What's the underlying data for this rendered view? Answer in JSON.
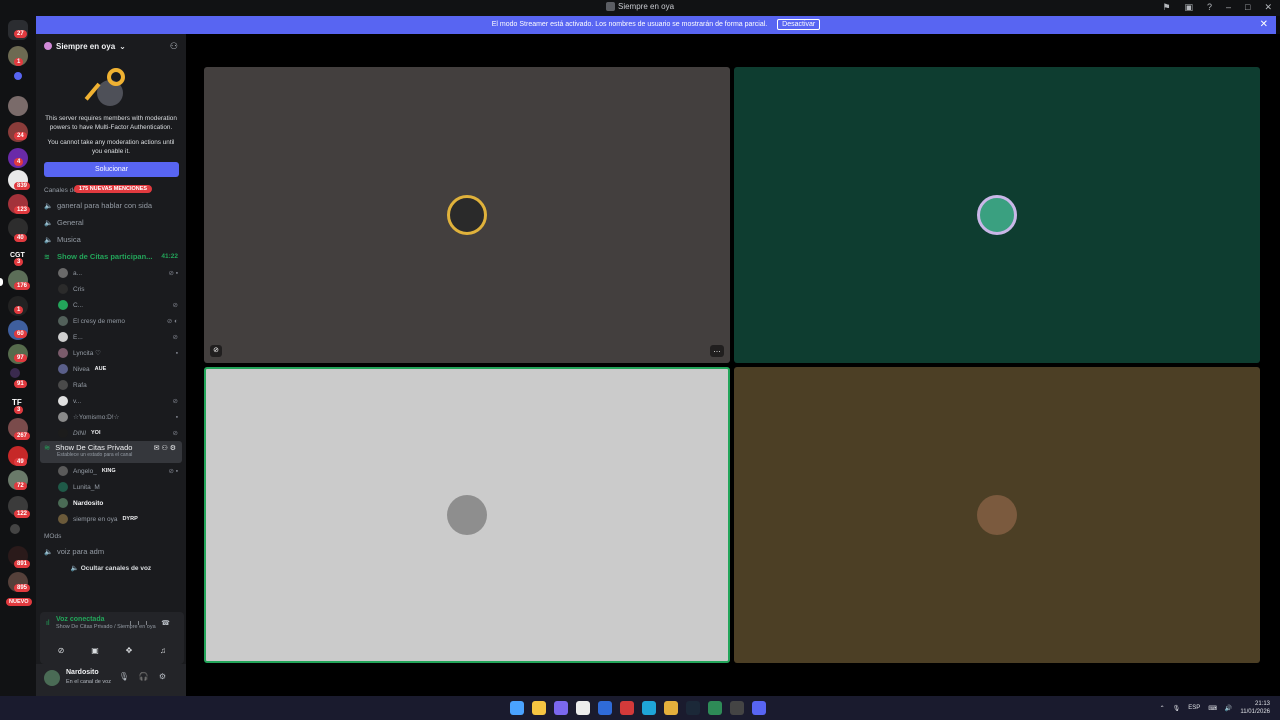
{
  "window": {
    "title": "Siempre en oya"
  },
  "banner": {
    "text": "El modo Streamer está activado. Los nombres de usuario se mostrarán de forma parcial.",
    "button": "Desactivar"
  },
  "rail_badges": [
    "27",
    "1",
    "24",
    "4",
    "839",
    "123",
    "40",
    "3",
    "176",
    "1",
    "60",
    "97",
    "91",
    "3",
    "267",
    "49",
    "72",
    "122",
    "891",
    "895"
  ],
  "rail_new": "NUEVO",
  "rail_text": {
    "cgt": "CGT",
    "tf": "TF"
  },
  "server": {
    "name": "Siempre en oya",
    "mfa_line1": "This server requires members with moderation powers to have Multi-Factor Authentication.",
    "mfa_line2": "You cannot take any moderation actions until you enable it.",
    "fix_button": "Solucionar"
  },
  "category": {
    "name": "Canales de",
    "mentions": "175 NUEVAS MENCIONES"
  },
  "channels": {
    "c1": "ganeral para hablar con sida",
    "c2": "General",
    "c3": "Musica",
    "active": "Show de Citas participan...",
    "active_timer": "41:22"
  },
  "voice_users_1": [
    {
      "name": "a...",
      "tag": ""
    },
    {
      "name": "Cris",
      "tag": ""
    },
    {
      "name": "C...",
      "tag": ""
    },
    {
      "name": "El cresy de memo",
      "tag": ""
    },
    {
      "name": "E...",
      "tag": ""
    },
    {
      "name": "Lyncita ♡",
      "tag": ""
    },
    {
      "name": "Nivea",
      "tag": "AUE"
    },
    {
      "name": "Rafa",
      "tag": ""
    },
    {
      "name": "v...",
      "tag": ""
    },
    {
      "name": "☆Yomismo:D!☆",
      "tag": ""
    },
    {
      "name": "DINI",
      "tag": "YOI"
    }
  ],
  "private_channel": {
    "name": "Show De Citas Privado",
    "status": "Establece un estado para el canal"
  },
  "voice_users_2": [
    {
      "name": "Angelo_",
      "tag": "KING"
    },
    {
      "name": "Lunita_M",
      "tag": ""
    },
    {
      "name": "Nardosito",
      "tag": ""
    },
    {
      "name": "siempre en oya",
      "tag": "DYRP"
    }
  ],
  "mods_category": "MOds",
  "mods_channel": "voiz para adm",
  "hide_voice": "Ocultar canales de voz",
  "voice_panel": {
    "status": "Voz conectada",
    "location": "Show De Citas Privado / Siempre en oya"
  },
  "user": {
    "name": "Nardosito",
    "status": "En el canal de voz"
  },
  "tiles": [
    {
      "bg": "#433f3e"
    },
    {
      "bg": "#0e3d30"
    },
    {
      "bg": "#cbcbcb"
    },
    {
      "bg": "#4c3f25"
    }
  ],
  "taskbar": {
    "lang": "ESP",
    "time": "21:13",
    "date": "11/01/2026"
  }
}
